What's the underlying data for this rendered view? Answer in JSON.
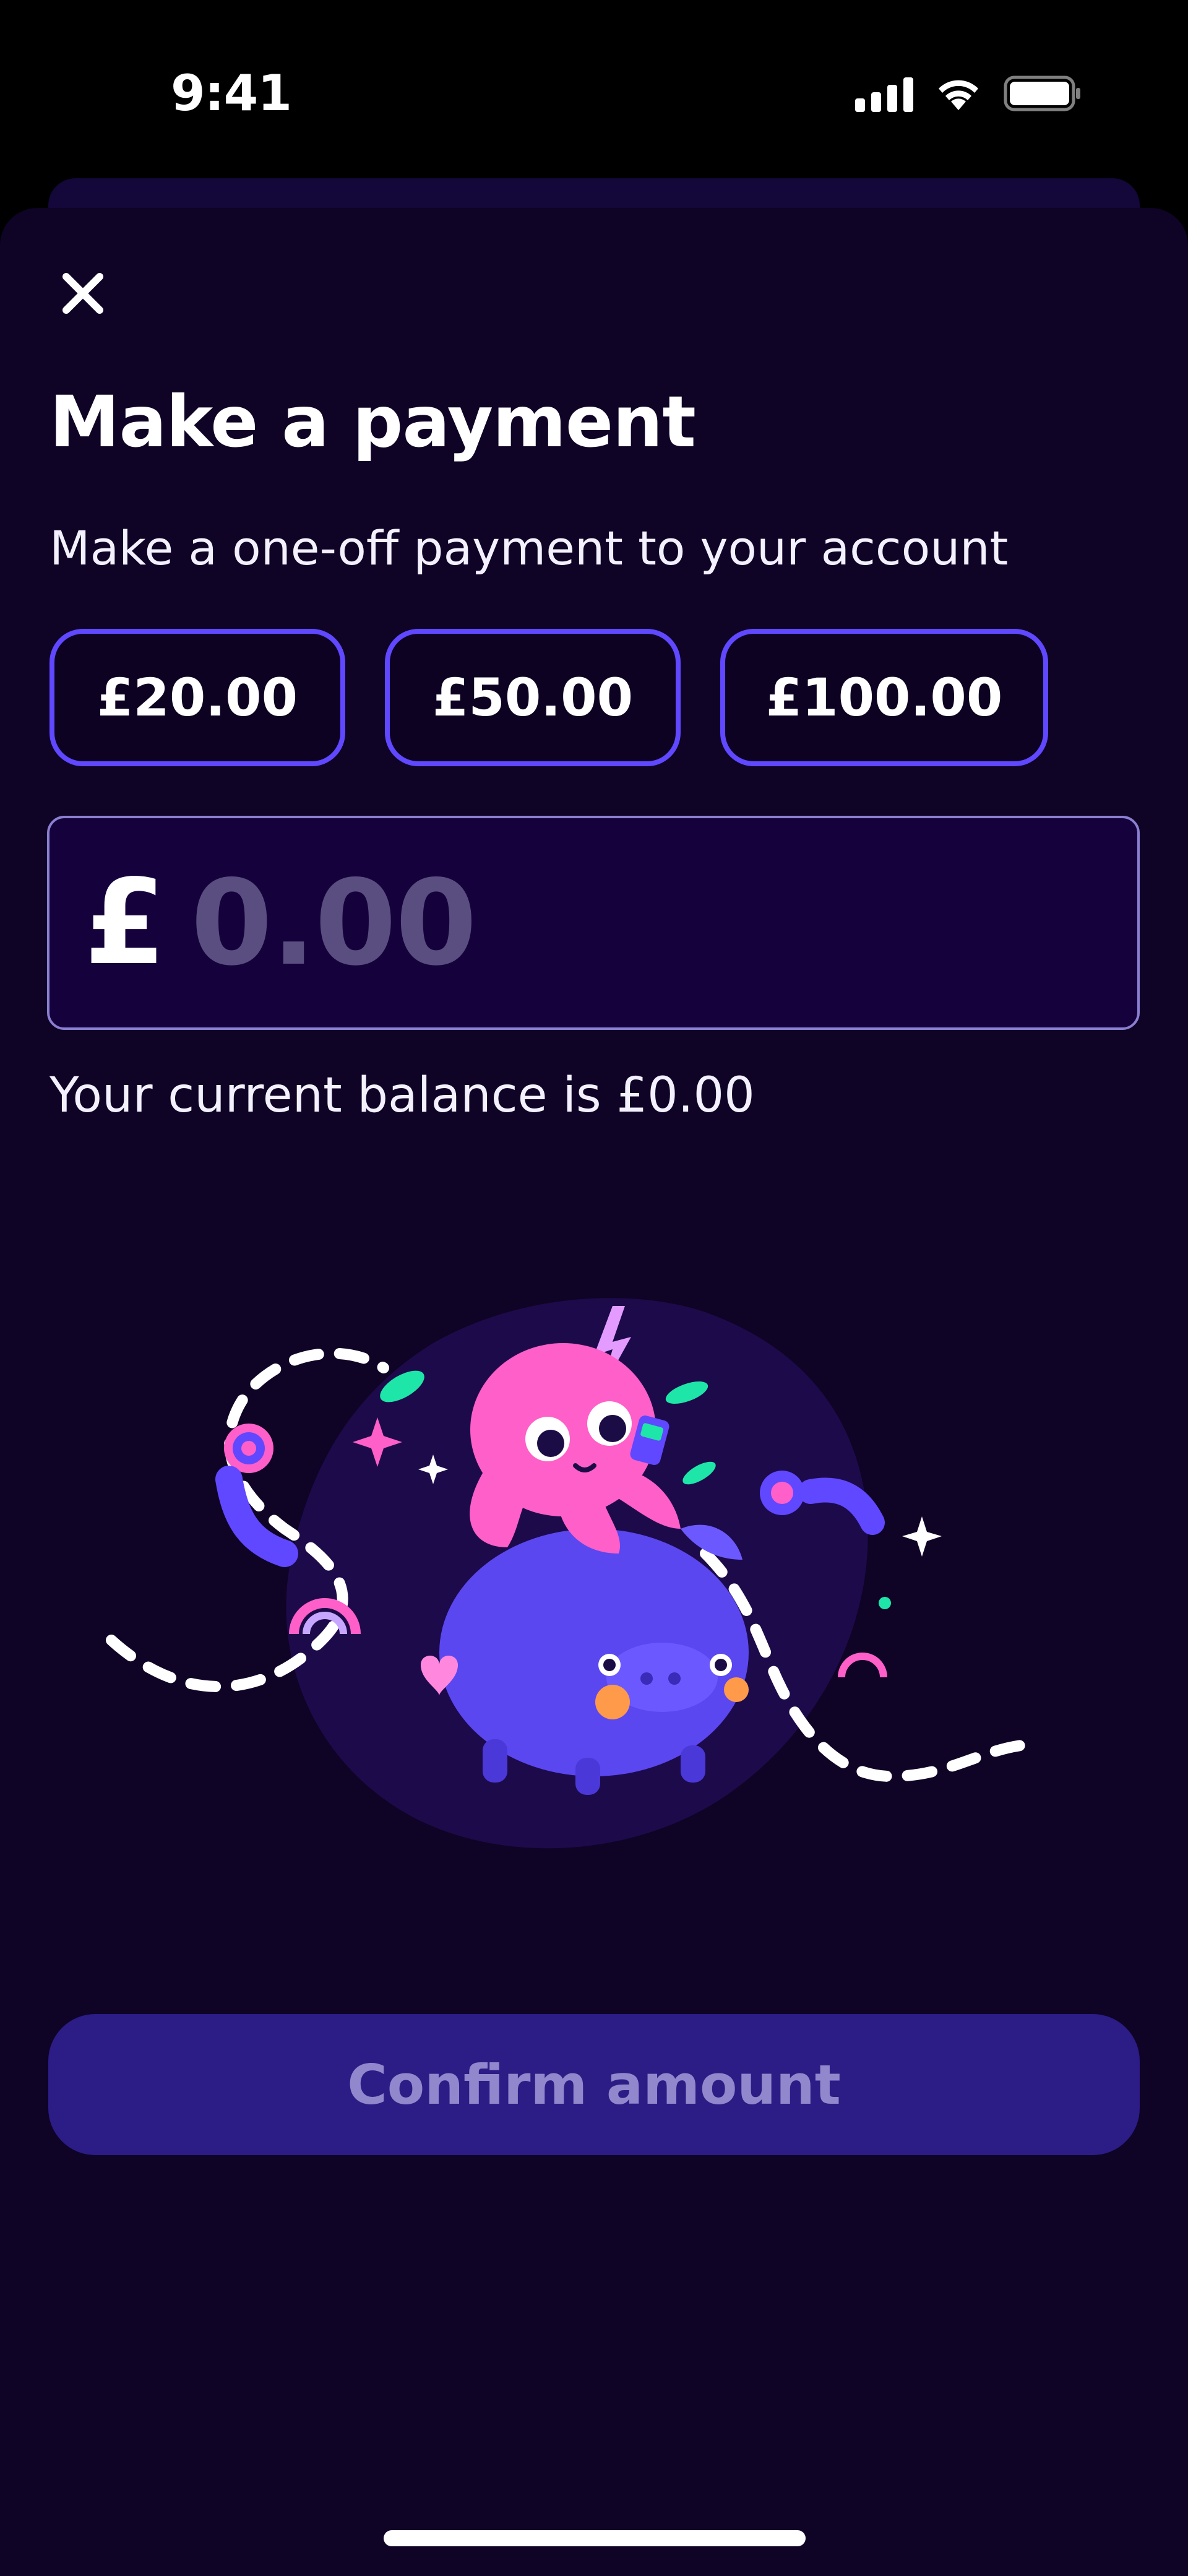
{
  "status_bar": {
    "time": "9:41",
    "icons": [
      "cellular-signal-icon",
      "wifi-icon",
      "battery-icon"
    ]
  },
  "modal": {
    "close_icon": "close-icon",
    "title": "Make a payment",
    "subtitle": "Make a one-off payment to your account",
    "quick_amounts": [
      "£20.00",
      "£50.00",
      "£100.00"
    ],
    "amount_input": {
      "currency_symbol": "£",
      "value": "",
      "placeholder": "0.00"
    },
    "balance_text": "Your current balance is £0.00",
    "illustration": "octopus-on-piggy-bank-illustration",
    "confirm_button": "Confirm amount"
  },
  "colors": {
    "background": "#0f0326",
    "accent": "#5f48ff",
    "input_background": "#15023d",
    "button_disabled": "#2c1c86",
    "octopus": "#ff5fc8",
    "piggy": "#5a47f0"
  }
}
